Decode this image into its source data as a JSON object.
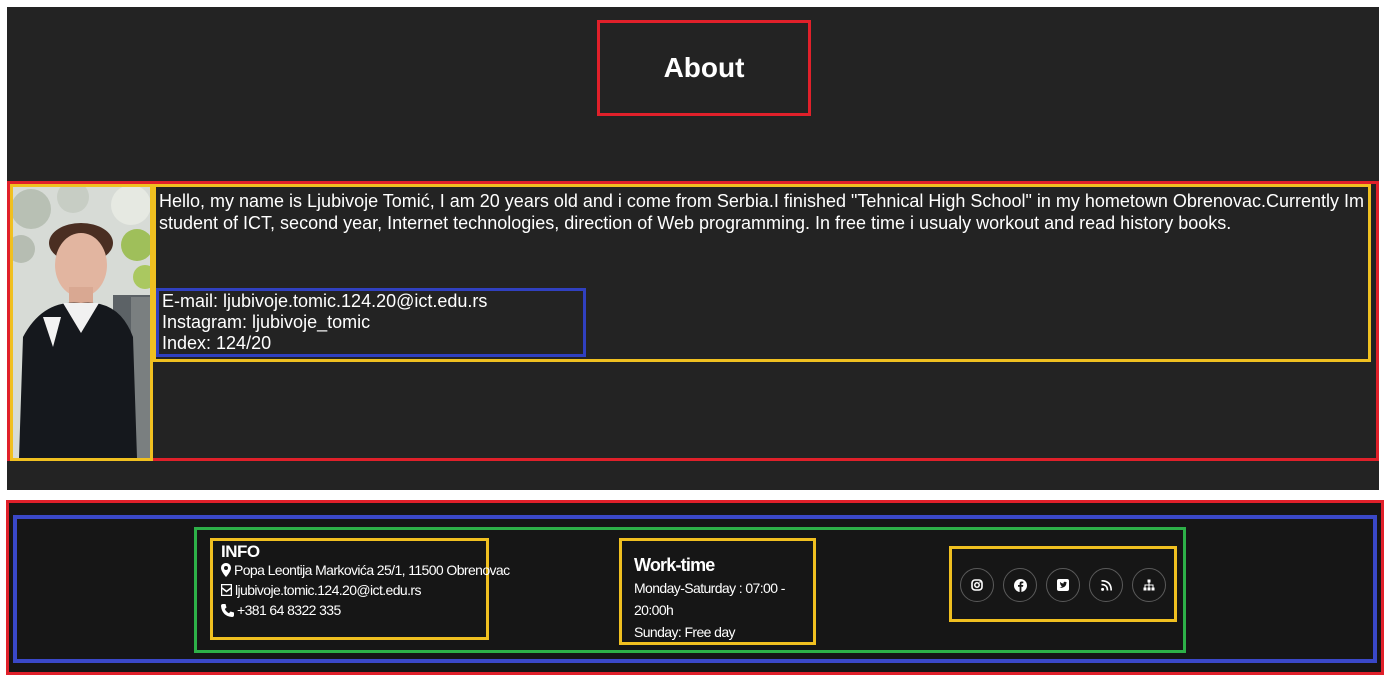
{
  "about": {
    "title": "About",
    "bio": "Hello, my name is Ljubivoje Tomić, I am 20 years old and i come from Serbia.I finished \"Tehnical High School\" in my hometown Obrenovac.Currently Im student of ICT, second year, Internet technologies, direction of Web programming. In free time i usualy workout and read history books.",
    "contacts": {
      "email": "E-mail: ljubivoje.tomic.124.20@ict.edu.rs",
      "instagram": "Instagram: ljubivoje_tomic",
      "index": "Index: 124/20"
    }
  },
  "footer": {
    "info": {
      "heading": "INFO",
      "address": "Popa Leontija Markovića 25/1, 11500 Obrenovac",
      "email": "ljubivoje.tomic.124.20@ict.edu.rs",
      "phone": "+381 64 8322 335"
    },
    "worktime": {
      "heading": "Work-time",
      "weekdays": "Monday-Saturday : 07:00 - 20:00h",
      "sunday": "Sunday: Free day"
    },
    "social": [
      "instagram-icon",
      "facebook-icon",
      "twitter-icon",
      "rss-icon",
      "sitemap-icon"
    ]
  },
  "colors": {
    "background": "#232323",
    "footer_background": "#161616",
    "outline_red": "#e0202a",
    "outline_yellow": "#f0c020",
    "outline_blue": "#3a48c8",
    "outline_green": "#2db048"
  }
}
